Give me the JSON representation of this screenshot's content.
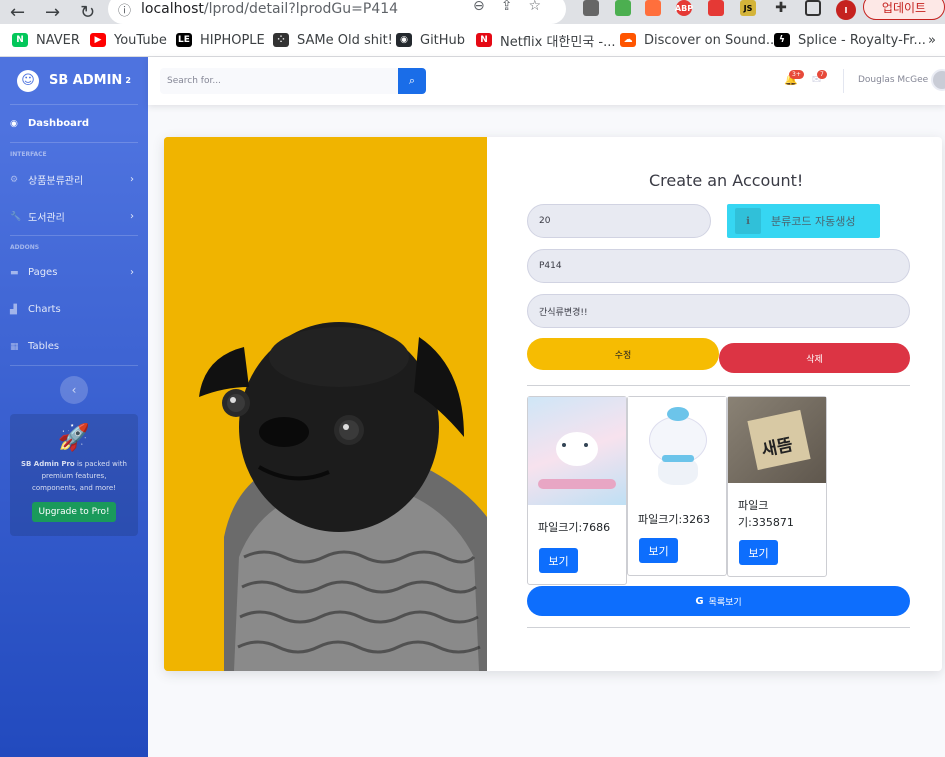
{
  "browser": {
    "url_host": "localhost",
    "url_path": "/lprod/detail?lprodGu=P414",
    "update_label": "업데이트",
    "extensions": [
      {
        "icon": "l-ext-icon",
        "color": "#666"
      },
      {
        "icon": "screen-ext-icon",
        "color": "#4caf50"
      },
      {
        "icon": "fx-ext-icon",
        "color": "#ff6f3c"
      },
      {
        "icon": "abp-ext-icon",
        "color": "#e53935",
        "text": "ABP"
      },
      {
        "icon": "msg-ext-icon",
        "color": "#e53935"
      },
      {
        "icon": "js-ext-icon",
        "color": "#d4b43a",
        "text": "JS"
      }
    ],
    "profile": "I"
  },
  "bookmarks": [
    {
      "label": "NAVER",
      "icon": "naver-icon",
      "color": "#03c75a",
      "ic": "N"
    },
    {
      "label": "YouTube",
      "icon": "youtube-icon",
      "color": "#ff0000",
      "ic": "▶"
    },
    {
      "label": "HIPHOPLE",
      "icon": "hiphople-icon",
      "color": "#000",
      "ic": "LE"
    },
    {
      "label": "SAMe Old shit!",
      "icon": "dots-icon",
      "color": "#333",
      "ic": "⁘"
    },
    {
      "label": "GitHub",
      "icon": "github-icon",
      "color": "#24292e",
      "ic": "◉"
    },
    {
      "label": "Netflix 대한민국 -...",
      "icon": "netflix-icon",
      "color": "#e50914",
      "ic": "N"
    },
    {
      "label": "Discover on Sound...",
      "icon": "soundcloud-icon",
      "color": "#ff5500",
      "ic": "☁"
    },
    {
      "label": "Splice - Royalty-Fr...",
      "icon": "splice-icon",
      "color": "#000",
      "ic": "ϟ"
    }
  ],
  "sidebar": {
    "brand": "SB ADMIN",
    "brand_sup": "2",
    "dashboard": "Dashboard",
    "interface_head": "INTERFACE",
    "item_category": "상품분류관리",
    "item_books": "도서관리",
    "addons_head": "ADDONS",
    "pages": "Pages",
    "charts": "Charts",
    "tables": "Tables",
    "promo_title": "SB Admin Pro",
    "promo_text": " is packed with premium features, components, and more!",
    "promo_btn": "Upgrade to Pro!"
  },
  "topbar": {
    "search_placeholder": "Search for...",
    "alerts_badge": "3+",
    "messages_badge": "7",
    "user_name": "Douglas McGee"
  },
  "form": {
    "title": "Create an Account!",
    "code_value": "20",
    "auto_btn": "분류코드 자동생성",
    "lprod_gu": "P414",
    "lprod_nm": "간식류변경!!",
    "edit_btn": "수정",
    "delete_btn": "삭제",
    "list_btn": "목록보기",
    "list_btn_icon": "G"
  },
  "files": [
    {
      "size_text": "파일크기:7686",
      "view": "보기",
      "image": "cinnamoroll-sticker-book"
    },
    {
      "size_text": "파일크기:3263",
      "view": "보기",
      "image": "cinnamoroll-plush"
    },
    {
      "size_text": "파일크기:335871",
      "view": "보기",
      "image": "tag-photo"
    }
  ],
  "colors": {
    "primary": "#4e73df",
    "blue": "#0d6efd",
    "warning": "#f6bc02",
    "danger": "#dc3444",
    "info": "#36d6f2",
    "photo_bg": "#f0b400"
  }
}
